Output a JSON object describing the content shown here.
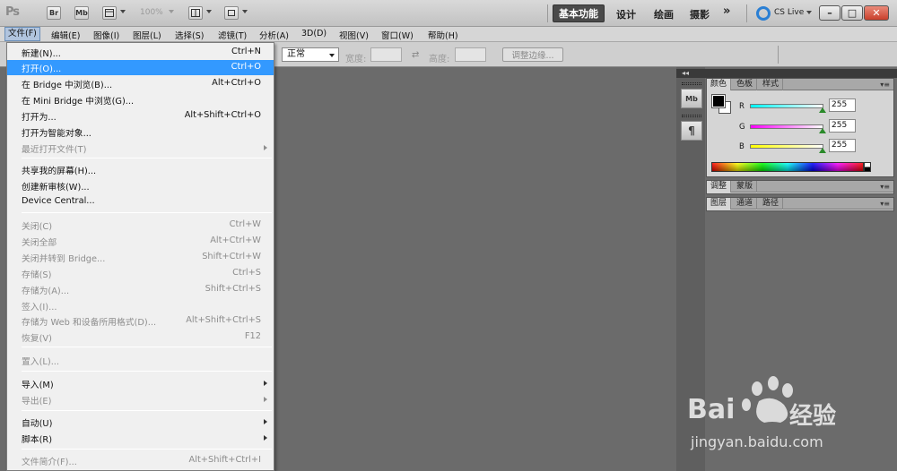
{
  "appbar": {
    "logo": "Ps",
    "bridge_btn": "Br",
    "minibridge_btn": "Mb",
    "zoom": "100%",
    "workspaces": [
      "基本功能",
      "设计",
      "绘画",
      "摄影"
    ],
    "more": "»",
    "cslive": "CS Live",
    "window_buttons": [
      "–",
      "□",
      "✕"
    ]
  },
  "menubar": {
    "items": [
      "文件(F)",
      "编辑(E)",
      "图像(I)",
      "图层(L)",
      "选择(S)",
      "滤镜(T)",
      "分析(A)",
      "3D(D)",
      "视图(V)",
      "窗口(W)",
      "帮助(H)"
    ]
  },
  "options": {
    "style_value": "正常",
    "width_label": "宽度:",
    "height_label": "高度:",
    "refine_button": "调整边缘..."
  },
  "file_menu": {
    "items": [
      {
        "label": "新建(N)...",
        "shortcut": "Ctrl+N",
        "disabled": false
      },
      {
        "label": "打开(O)...",
        "shortcut": "Ctrl+O",
        "disabled": false,
        "highlighted": true
      },
      {
        "label": "在 Bridge 中浏览(B)...",
        "shortcut": "Alt+Ctrl+O",
        "disabled": false
      },
      {
        "label": "在 Mini Bridge 中浏览(G)...",
        "shortcut": "",
        "disabled": false
      },
      {
        "label": "打开为...",
        "shortcut": "Alt+Shift+Ctrl+O",
        "disabled": false
      },
      {
        "label": "打开为智能对象...",
        "shortcut": "",
        "disabled": false
      },
      {
        "label": "最近打开文件(T)",
        "shortcut": "",
        "disabled": true,
        "submenu": true
      },
      {
        "label": "共享我的屏幕(H)...",
        "shortcut": "",
        "disabled": false
      },
      {
        "label": "创建新审核(W)...",
        "shortcut": "",
        "disabled": false
      },
      {
        "label": "Device Central...",
        "shortcut": "",
        "disabled": false
      },
      {
        "label": "关闭(C)",
        "shortcut": "Ctrl+W",
        "disabled": true
      },
      {
        "label": "关闭全部",
        "shortcut": "Alt+Ctrl+W",
        "disabled": true
      },
      {
        "label": "关闭并转到 Bridge...",
        "shortcut": "Shift+Ctrl+W",
        "disabled": true
      },
      {
        "label": "存储(S)",
        "shortcut": "Ctrl+S",
        "disabled": true
      },
      {
        "label": "存储为(A)...",
        "shortcut": "Shift+Ctrl+S",
        "disabled": true
      },
      {
        "label": "签入(I)...",
        "shortcut": "",
        "disabled": true
      },
      {
        "label": "存储为 Web 和设备所用格式(D)...",
        "shortcut": "Alt+Shift+Ctrl+S",
        "disabled": true
      },
      {
        "label": "恢复(V)",
        "shortcut": "F12",
        "disabled": true
      },
      {
        "label": "置入(L)...",
        "shortcut": "",
        "disabled": true
      },
      {
        "label": "导入(M)",
        "shortcut": "",
        "disabled": false,
        "submenu": true
      },
      {
        "label": "导出(E)",
        "shortcut": "",
        "disabled": true,
        "submenu": true
      },
      {
        "label": "自动(U)",
        "shortcut": "",
        "disabled": false,
        "submenu": true
      },
      {
        "label": "脚本(R)",
        "shortcut": "",
        "disabled": false,
        "submenu": true
      },
      {
        "label": "文件简介(F)...",
        "shortcut": "Alt+Shift+Ctrl+I",
        "disabled": true
      }
    ]
  },
  "panels": {
    "dock_icons": [
      "Mb",
      "¶"
    ],
    "color_tabs": [
      "颜色",
      "色板",
      "样式"
    ],
    "sliders": [
      {
        "label": "R",
        "value": "255"
      },
      {
        "label": "G",
        "value": "255"
      },
      {
        "label": "B",
        "value": "255"
      }
    ],
    "adjust_tabs": [
      "调整",
      "蒙版"
    ],
    "layer_tabs": [
      "图层",
      "通道",
      "路径"
    ]
  },
  "watermark": {
    "brand": "Bai",
    "brand2": "经验",
    "url": "jingyan.baidu.com"
  },
  "colors": {
    "highlight": "#3399ff",
    "workspace_active": "#4a4a4a",
    "canvas": "#6b6b6b"
  }
}
